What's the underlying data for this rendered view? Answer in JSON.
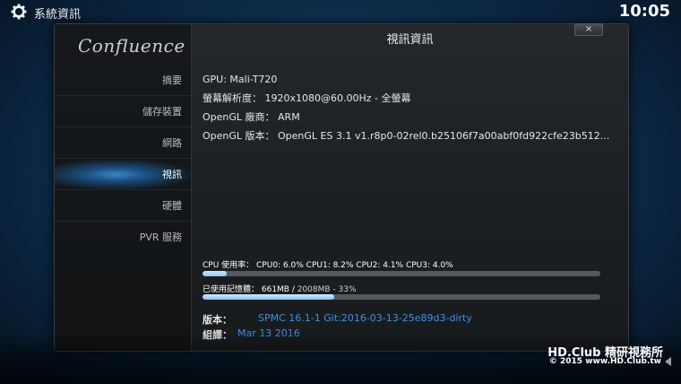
{
  "header": {
    "title": "系統資訊",
    "clock": "10:05"
  },
  "sidebar": {
    "logo": "Confluence",
    "items": [
      {
        "label": "摘要",
        "active": false
      },
      {
        "label": "儲存裝置",
        "active": false
      },
      {
        "label": "網路",
        "active": false
      },
      {
        "label": "視訊",
        "active": true
      },
      {
        "label": "硬體",
        "active": false
      },
      {
        "label": "PVR 服務",
        "active": false
      }
    ]
  },
  "dialog": {
    "title": "視訊資訊",
    "close_label": "×",
    "info_lines": [
      "GPU: Mali-T720",
      "螢幕解析度： 1920x1080@60.00Hz - 全螢幕",
      "OpenGL 廠商： ARM",
      "OpenGL 版本： OpenGL ES 3.1 v1.r8p0-02rel0.b25106f7a00abf0fd922cfe23b512..."
    ],
    "cpu": {
      "label": "CPU 使用率： CPU0: 6.0% CPU1: 8.2% CPU2: 4.1% CPU3: 4.0%",
      "usage_percent": 6
    },
    "memory": {
      "label_prefix": "已使用記憶體： 661MB / ",
      "label_suffix": "2008MB - 33%",
      "usage_percent": 33
    },
    "version": {
      "key": "版本：",
      "value": "SPMC 16.1-1 Git:2016-03-13-25e89d3-dirty"
    },
    "build": {
      "key": "組譯：",
      "value": "Mar 13 2016"
    }
  },
  "watermark": {
    "line1": "HD.Club 精研視務所",
    "line2": "© 2015  www.HD.Club.tw"
  },
  "colors": {
    "accent": "#3f8fe0",
    "bar_fill": "#8cc4ee",
    "bar_track": "#55595d"
  }
}
